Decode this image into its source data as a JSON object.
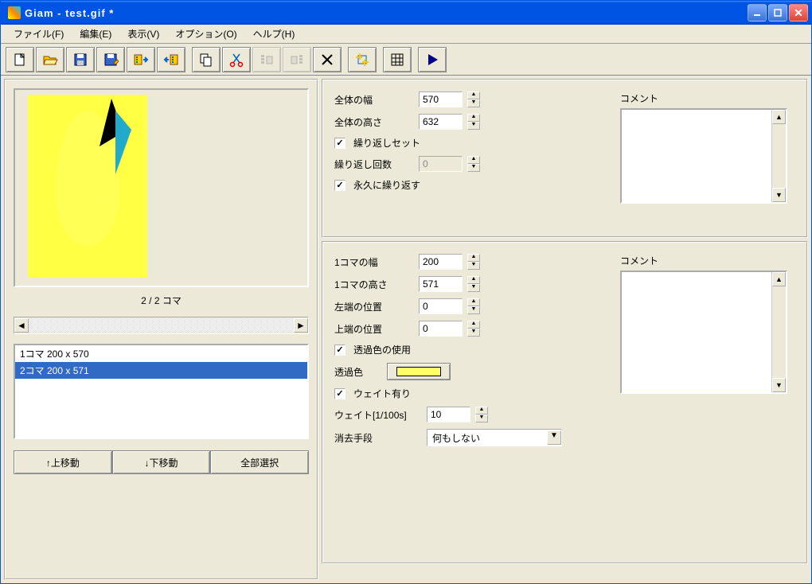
{
  "window": {
    "title": "Giam - test.gif *"
  },
  "menu": {
    "file": "ファイル(F)",
    "edit": "編集(E)",
    "view": "表示(V)",
    "options": "オプション(O)",
    "help": "ヘルプ(H)"
  },
  "left": {
    "frame_counter": "2 / 2 コマ",
    "frames": [
      "1コマ 200 x 570",
      "2コマ 200 x 571"
    ],
    "btn_up": "↑上移動",
    "btn_down": "↓下移動",
    "btn_all": "全部選択"
  },
  "global": {
    "width_label": "全体の幅",
    "width_val": "570",
    "height_label": "全体の高さ",
    "height_val": "632",
    "loop_set_label": "繰り返しセット",
    "loop_count_label": "繰り返し回数",
    "loop_count_val": "0",
    "loop_forever_label": "永久に繰り返す",
    "comment_label": "コメント"
  },
  "frame": {
    "width_label": "1コマの幅",
    "width_val": "200",
    "height_label": "1コマの高さ",
    "height_val": "571",
    "left_label": "左端の位置",
    "left_val": "0",
    "top_label": "上端の位置",
    "top_val": "0",
    "trans_use_label": "透過色の使用",
    "trans_color_label": "透過色",
    "wait_on_label": "ウェイト有り",
    "wait_label": "ウェイト[1/100s]",
    "wait_val": "10",
    "dispose_label": "消去手段",
    "dispose_val": "何もしない",
    "comment_label": "コメント"
  }
}
